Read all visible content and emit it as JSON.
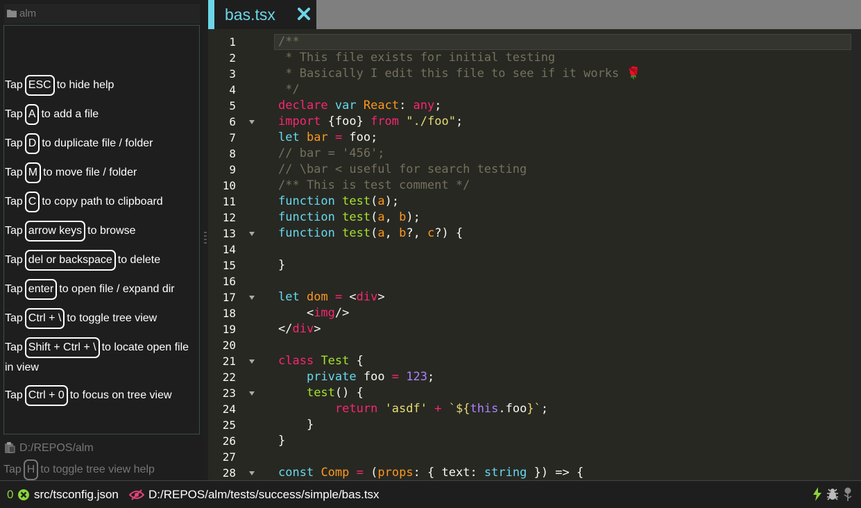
{
  "tree": {
    "root_label": "alm",
    "repo_path": "D:/REPOS/alm",
    "help": [
      {
        "pre": "Tap",
        "key": "ESC",
        "post": "to hide help"
      },
      {
        "pre": "Tap",
        "key": "A",
        "post": "to add a file"
      },
      {
        "pre": "Tap",
        "key": "D",
        "post": "to duplicate file / folder"
      },
      {
        "pre": "Tap",
        "key": "M",
        "post": "to move file / folder"
      },
      {
        "pre": "Tap",
        "key": "C",
        "post": "to copy path to clipboard"
      },
      {
        "pre": "Tap",
        "key": "arrow keys",
        "post": "to browse"
      },
      {
        "pre": "Tap",
        "key": "del or backspace",
        "post": "to delete"
      },
      {
        "pre": "Tap",
        "key": "enter",
        "post": "to open file / expand dir"
      },
      {
        "pre": "Tap",
        "key": "Ctrl + \\",
        "post": "to toggle tree view"
      },
      {
        "pre": "Tap",
        "key": "Shift + Ctrl + \\",
        "post": "to locate open file in view"
      },
      {
        "pre": "Tap",
        "key": "Ctrl + 0",
        "post": "to focus on tree view"
      }
    ],
    "toggle_help": {
      "pre": "Tap",
      "key": "H",
      "post": "to toggle tree view help"
    }
  },
  "editor": {
    "tab_title": "bas.tsx",
    "line_numbers": [
      "1",
      "2",
      "3",
      "4",
      "5",
      "6",
      "7",
      "8",
      "9",
      "10",
      "11",
      "12",
      "13",
      "14",
      "15",
      "16",
      "17",
      "18",
      "19",
      "20",
      "21",
      "22",
      "23",
      "24",
      "25",
      "26",
      "27",
      "28"
    ],
    "code": [
      [
        [
          "com",
          "/**"
        ]
      ],
      [
        [
          "com",
          " * This file exists for initial testing"
        ]
      ],
      [
        [
          "com",
          " * Basically I edit this file to see if it works 🌹"
        ]
      ],
      [
        [
          "com",
          " */"
        ]
      ],
      [
        [
          "key",
          "declare"
        ],
        [
          "pun",
          " "
        ],
        [
          "kw",
          "var"
        ],
        [
          "pun",
          " "
        ],
        [
          "var",
          "React"
        ],
        [
          "pun",
          ": "
        ],
        [
          "key",
          "any"
        ],
        [
          "pun",
          ";"
        ]
      ],
      [
        [
          "key",
          "import"
        ],
        [
          "pun",
          " {foo} "
        ],
        [
          "key",
          "from"
        ],
        [
          "pun",
          " "
        ],
        [
          "str",
          "\"./foo\""
        ],
        [
          "pun",
          ";"
        ]
      ],
      [
        [
          "kw",
          "let"
        ],
        [
          "pun",
          " "
        ],
        [
          "var",
          "bar"
        ],
        [
          "pun",
          " "
        ],
        [
          "key",
          "="
        ],
        [
          "pun",
          " foo;"
        ]
      ],
      [
        [
          "com",
          "// bar = '456';"
        ]
      ],
      [
        [
          "com",
          "// \\bar < useful for search testing"
        ]
      ],
      [
        [
          "com",
          "/** This is test comment */"
        ]
      ],
      [
        [
          "kw",
          "function"
        ],
        [
          "pun",
          " "
        ],
        [
          "typ",
          "test"
        ],
        [
          "pun",
          "("
        ],
        [
          "var",
          "a"
        ],
        [
          "pun",
          ");"
        ]
      ],
      [
        [
          "kw",
          "function"
        ],
        [
          "pun",
          " "
        ],
        [
          "typ",
          "test"
        ],
        [
          "pun",
          "("
        ],
        [
          "var",
          "a"
        ],
        [
          "pun",
          ", "
        ],
        [
          "var",
          "b"
        ],
        [
          "pun",
          ");"
        ]
      ],
      [
        [
          "kw",
          "function"
        ],
        [
          "pun",
          " "
        ],
        [
          "typ",
          "test"
        ],
        [
          "pun",
          "("
        ],
        [
          "var",
          "a"
        ],
        [
          "pun",
          ", "
        ],
        [
          "var",
          "b"
        ],
        [
          "pun",
          "?, "
        ],
        [
          "var",
          "c"
        ],
        [
          "pun",
          "?) {"
        ]
      ],
      [
        [
          "pun",
          ""
        ]
      ],
      [
        [
          "pun",
          "}"
        ]
      ],
      [
        [
          "pun",
          ""
        ]
      ],
      [
        [
          "kw",
          "let"
        ],
        [
          "pun",
          " "
        ],
        [
          "var",
          "dom"
        ],
        [
          "pun",
          " "
        ],
        [
          "key",
          "="
        ],
        [
          "pun",
          " <"
        ],
        [
          "tag",
          "div"
        ],
        [
          "pun",
          ">"
        ]
      ],
      [
        [
          "pun",
          "    <"
        ],
        [
          "tag",
          "img"
        ],
        [
          "pun",
          "/>"
        ]
      ],
      [
        [
          "pun",
          "</"
        ],
        [
          "tag",
          "div"
        ],
        [
          "pun",
          ">"
        ]
      ],
      [
        [
          "pun",
          ""
        ]
      ],
      [
        [
          "key",
          "class"
        ],
        [
          "pun",
          " "
        ],
        [
          "typ",
          "Test"
        ],
        [
          "pun",
          " {"
        ]
      ],
      [
        [
          "pun",
          "    "
        ],
        [
          "kw",
          "private"
        ],
        [
          "pun",
          " foo "
        ],
        [
          "key",
          "="
        ],
        [
          "pun",
          " "
        ],
        [
          "num",
          "123"
        ],
        [
          "pun",
          ";"
        ]
      ],
      [
        [
          "pun",
          "    "
        ],
        [
          "typ",
          "test"
        ],
        [
          "pun",
          "() {"
        ]
      ],
      [
        [
          "pun",
          "        "
        ],
        [
          "key",
          "return"
        ],
        [
          "pun",
          " "
        ],
        [
          "str",
          "'asdf'"
        ],
        [
          "pun",
          " "
        ],
        [
          "key",
          "+"
        ],
        [
          "pun",
          " "
        ],
        [
          "str",
          "`${"
        ],
        [
          "num",
          "this"
        ],
        [
          "pun",
          ".foo"
        ],
        [
          "str",
          "}`"
        ],
        [
          "pun",
          ";"
        ]
      ],
      [
        [
          "pun",
          "    }"
        ]
      ],
      [
        [
          "pun",
          "}"
        ]
      ],
      [
        [
          "pun",
          ""
        ]
      ],
      [
        [
          "kw",
          "const"
        ],
        [
          "pun",
          " "
        ],
        [
          "var",
          "Comp"
        ],
        [
          "pun",
          " "
        ],
        [
          "key",
          "="
        ],
        [
          "pun",
          " ("
        ],
        [
          "var",
          "props"
        ],
        [
          "pun",
          ": { text: "
        ],
        [
          "kw",
          "string"
        ],
        [
          "pun",
          " }) => {"
        ]
      ]
    ],
    "fold_lines": [
      6,
      13,
      17,
      21,
      23,
      28
    ]
  },
  "status": {
    "error_count": "0",
    "config_path": "src/tsconfig.json",
    "file_path": "D:/REPOS/alm/tests/success/simple/bas.tsx"
  },
  "colors": {
    "accent": "#6cd6e8",
    "ok_green": "#8bd53a",
    "unsaved_pink": "#e0447a"
  }
}
